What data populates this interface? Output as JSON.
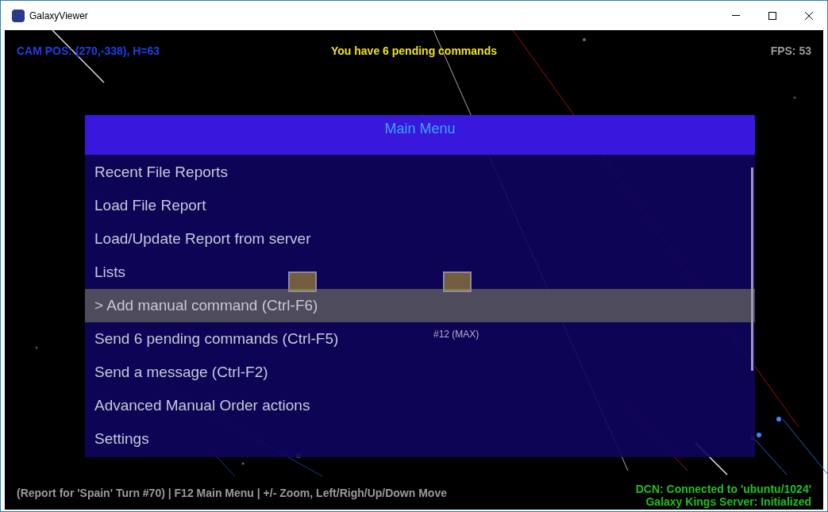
{
  "window": {
    "title": "GalaxyViewer"
  },
  "hud": {
    "camera": "CAM POS: (270,-338), H=63",
    "pending": "You have 6 pending commands",
    "fps": "FPS: 53"
  },
  "map_labels": [
    "#12 (MAX)"
  ],
  "menu": {
    "title": "Main Menu",
    "items": [
      {
        "label": "Recent File Reports",
        "selected": false
      },
      {
        "label": "Load File Report",
        "selected": false
      },
      {
        "label": "Load/Update Report from server",
        "selected": false
      },
      {
        "label": "Lists",
        "selected": false
      },
      {
        "label": "> Add manual command (Ctrl-F6)",
        "selected": true
      },
      {
        "label": "Send 6 pending commands (Ctrl-F5)",
        "selected": false
      },
      {
        "label": "Send a message (Ctrl-F2)",
        "selected": false
      },
      {
        "label": "Advanced Manual Order actions",
        "selected": false
      },
      {
        "label": "Settings",
        "selected": false
      }
    ]
  },
  "status": {
    "help": "(Report for 'Spain' Turn #70) | F12 Main Menu | +/- Zoom, Left/Righ/Up/Down Move",
    "connection": "DCN: Connected to 'ubuntu/1024'",
    "server": "Galaxy Kings Server: Initialized"
  }
}
